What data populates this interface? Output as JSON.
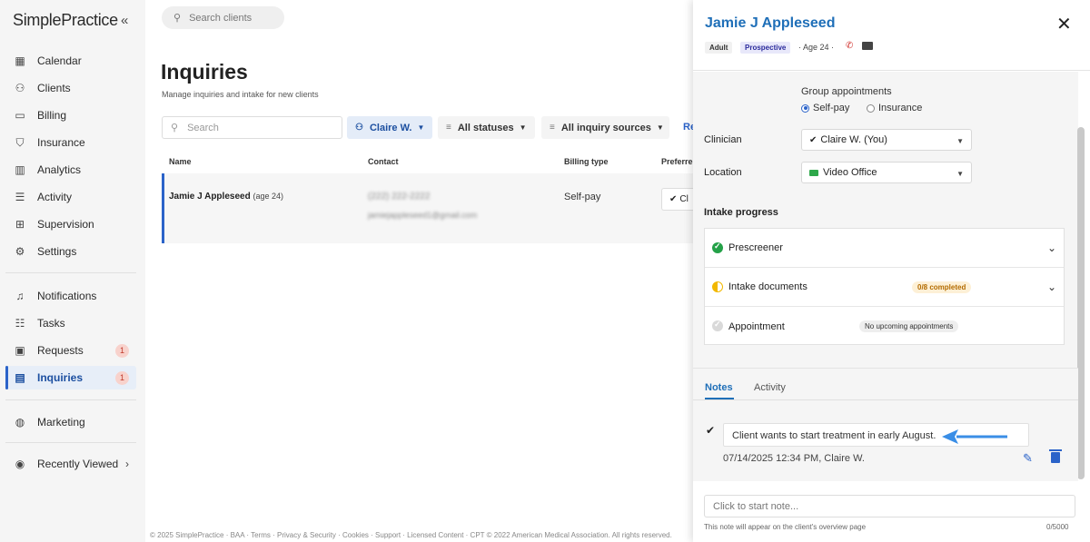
{
  "app": {
    "logo": "SimplePractice",
    "collapse_icon": "chevron-double-left-icon"
  },
  "sidebar": {
    "items": [
      {
        "label": "Calendar",
        "icon": "calendar-icon"
      },
      {
        "label": "Clients",
        "icon": "clients-icon"
      },
      {
        "label": "Billing",
        "icon": "billing-icon"
      },
      {
        "label": "Insurance",
        "icon": "shield-icon"
      },
      {
        "label": "Analytics",
        "icon": "analytics-icon"
      },
      {
        "label": "Activity",
        "icon": "activity-icon"
      },
      {
        "label": "Supervision",
        "icon": "supervision-icon"
      },
      {
        "label": "Settings",
        "icon": "gear-icon"
      },
      {
        "label": "Notifications",
        "icon": "bell-icon"
      },
      {
        "label": "Tasks",
        "icon": "tasks-icon"
      },
      {
        "label": "Requests",
        "icon": "requests-icon",
        "badge": "1"
      },
      {
        "label": "Inquiries",
        "icon": "inquiries-icon",
        "badge": "1",
        "active": true
      },
      {
        "label": "Marketing",
        "icon": "globe-icon"
      },
      {
        "label": "Recently Viewed",
        "icon": "eye-icon"
      }
    ]
  },
  "topbar": {
    "search_placeholder": "Search clients"
  },
  "main": {
    "title": "Inquiries",
    "subtitle": "Manage inquiries and intake for new clients",
    "search_placeholder": "Search",
    "filters": {
      "clinician": "Claire W.",
      "status": "All statuses",
      "source": "All inquiry sources",
      "link": "Re"
    },
    "table": {
      "headers": [
        "Name",
        "Contact",
        "Billing type",
        "Preferre"
      ],
      "rows": [
        {
          "name": "Jamie J Appleseed",
          "age": "(age 24)",
          "phone": "(222) 222-2222",
          "email": "jamiejappleseed1@gmail.com",
          "billing": "Self-pay",
          "preferred": "Cl"
        }
      ]
    },
    "footer": "© 2025 SimplePractice · BAA · Terms · Privacy & Security · Cookies · Support · Licensed Content · CPT © 2022 American Medical Association. All rights reserved."
  },
  "panel": {
    "client_name": "Jamie J Appleseed",
    "tags": {
      "adult": "Adult",
      "prospective": "Prospective",
      "age": "· Age 24 ·"
    },
    "group_appointments": {
      "label": "Group appointments",
      "options": [
        {
          "label": "Self-pay",
          "selected": true
        },
        {
          "label": "Insurance",
          "selected": false
        }
      ]
    },
    "clinician": {
      "label": "Clinician",
      "value": "Claire W. (You)"
    },
    "location": {
      "label": "Location",
      "value": "Video Office"
    },
    "intake": {
      "title": "Intake progress",
      "steps": [
        {
          "label": "Prescreener",
          "status": "done"
        },
        {
          "label": "Intake documents",
          "status": "partial",
          "pill": "0/8 completed"
        },
        {
          "label": "Appointment",
          "status": "none",
          "pill": "No upcoming appointments"
        }
      ]
    },
    "tabs": {
      "notes": "Notes",
      "activity": "Activity"
    },
    "note": {
      "text": "Client wants to start treatment in early August.",
      "meta": "07/14/2025 12:34 PM, Claire W."
    },
    "new_note": {
      "placeholder": "Click to start note...",
      "hint": "This note will appear on the client's overview page",
      "count": "0/5000"
    },
    "colors": {
      "accent": "#1f6fb8",
      "arrow": "#3a8ee6"
    }
  }
}
